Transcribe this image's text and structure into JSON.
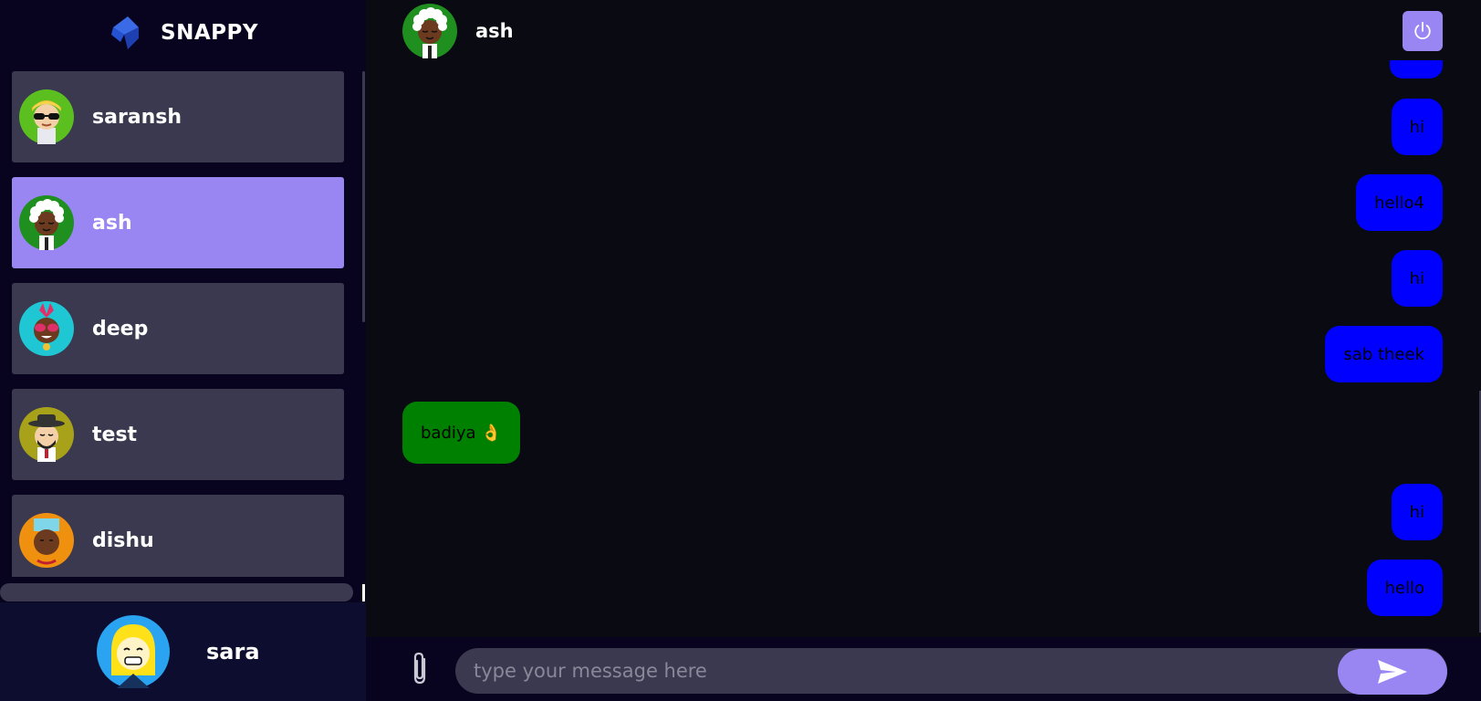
{
  "brand": {
    "name": "SNAPPY"
  },
  "contacts": [
    {
      "name": "saransh",
      "selected": false
    },
    {
      "name": "ash",
      "selected": true
    },
    {
      "name": "deep",
      "selected": false
    },
    {
      "name": "test",
      "selected": false
    },
    {
      "name": "dishu",
      "selected": false
    }
  ],
  "current_user": {
    "name": "sara"
  },
  "chat": {
    "contact_name": "ash",
    "messages": [
      {
        "text": "hi",
        "type": "sent"
      },
      {
        "text": "hello4",
        "type": "sent"
      },
      {
        "text": "hi",
        "type": "sent"
      },
      {
        "text": "sab theek",
        "type": "sent"
      },
      {
        "text": "badiya 👌",
        "type": "received"
      },
      {
        "text": "hi",
        "type": "sent"
      },
      {
        "text": "hello",
        "type": "sent"
      }
    ]
  },
  "input": {
    "placeholder": "type your message here",
    "value": ""
  },
  "icons": {
    "logout": "power-icon",
    "attach": "paperclip-icon",
    "send": "send-icon",
    "logo": "snappy-logo-icon"
  },
  "colors": {
    "accent": "#9a86f3",
    "contact_bg": "#3b3950",
    "sent_bubble": "#0000ff",
    "received_bubble": "#008000",
    "sidebar_bg": "#080420"
  }
}
